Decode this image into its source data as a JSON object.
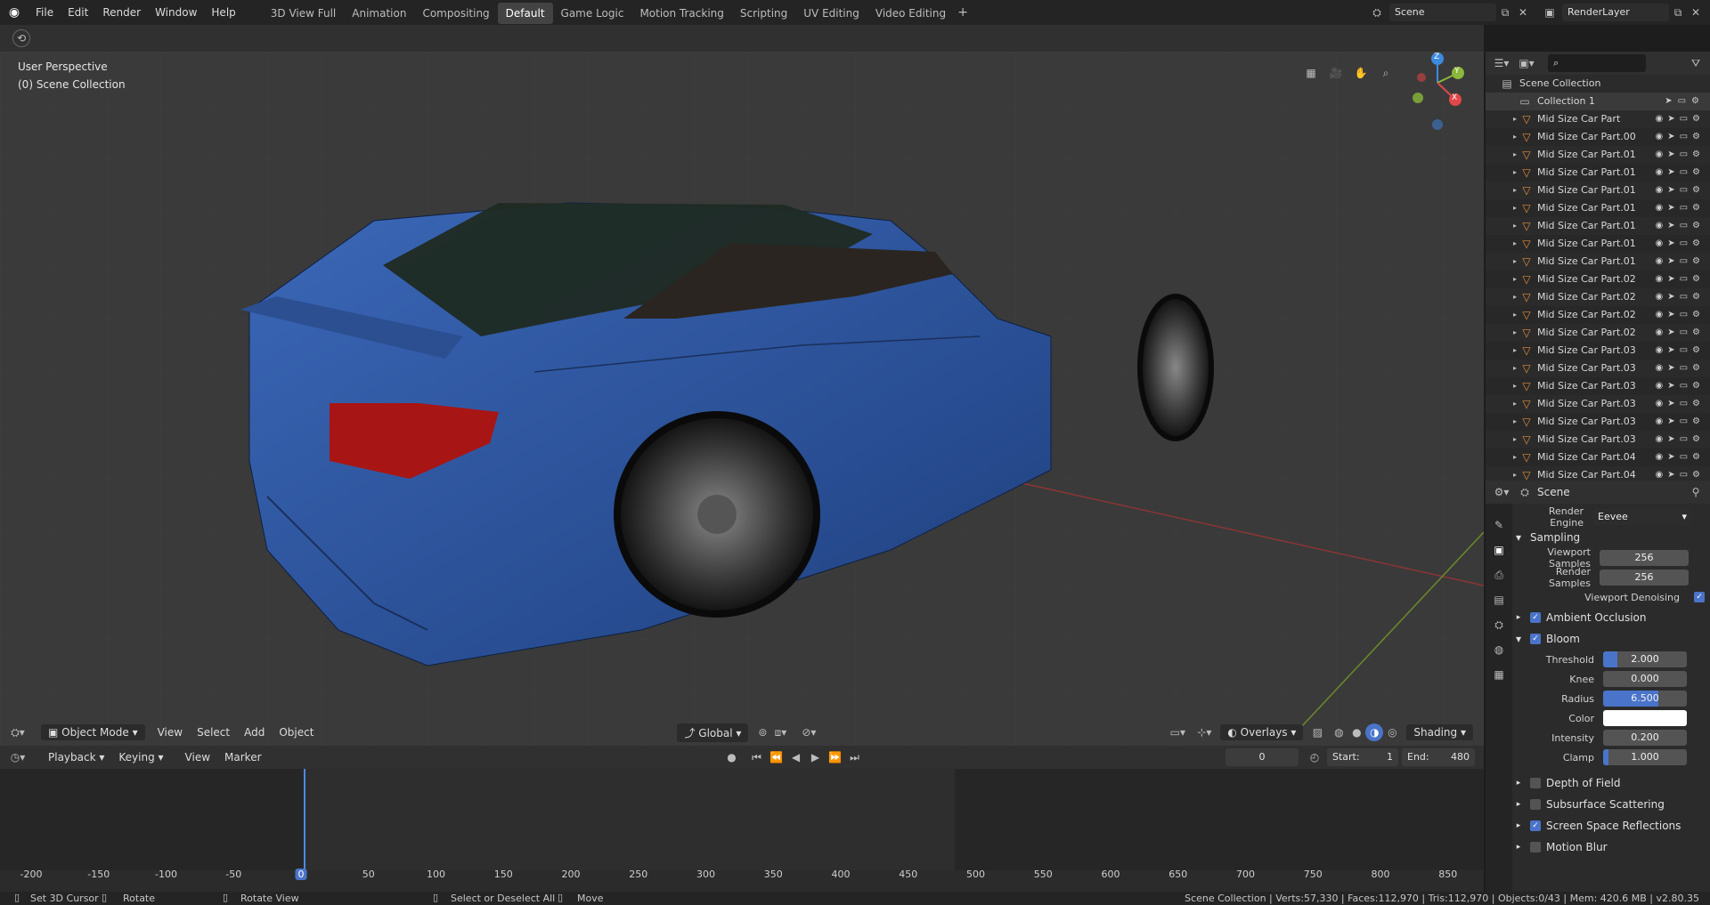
{
  "menu": [
    "File",
    "Edit",
    "Render",
    "Window",
    "Help"
  ],
  "workspaces": [
    {
      "label": "3D View Full",
      "active": false
    },
    {
      "label": "Animation",
      "active": false
    },
    {
      "label": "Compositing",
      "active": false
    },
    {
      "label": "Default",
      "active": true
    },
    {
      "label": "Game Logic",
      "active": false
    },
    {
      "label": "Motion Tracking",
      "active": false
    },
    {
      "label": "Scripting",
      "active": false
    },
    {
      "label": "UV Editing",
      "active": false
    },
    {
      "label": "Video Editing",
      "active": false
    }
  ],
  "scene_field": "Scene",
  "renderlayer_field": "RenderLayer",
  "viewport": {
    "perspective": "User Perspective",
    "collection": "(0) Scene Collection",
    "mode": "Object Mode",
    "menus": [
      "View",
      "Select",
      "Add",
      "Object"
    ],
    "transform": "Global",
    "overlays": "Overlays",
    "shading": "Shading",
    "gizmo": {
      "z": "Z",
      "y": "Y",
      "x": "X"
    }
  },
  "timeline": {
    "menus": [
      "Playback",
      "Keying",
      "View",
      "Marker"
    ],
    "current_frame": "0",
    "start_label": "Start:",
    "start": "1",
    "end_label": "End:",
    "end": "480",
    "ticks": [
      "-200",
      "-150",
      "-100",
      "-50",
      "0",
      "50",
      "100",
      "150",
      "200",
      "250",
      "300",
      "350",
      "400",
      "450",
      "500",
      "550",
      "600",
      "650",
      "700",
      "750",
      "800",
      "850"
    ]
  },
  "status": {
    "set_cursor": "Set 3D Cursor",
    "rotate": "Rotate",
    "rotate_view": "Rotate View",
    "select": "Select or Deselect All",
    "move": "Move",
    "info": "Scene Collection | Verts:57,330 | Faces:112,970 | Tris:112,970 | Objects:0/43 | Mem: 420.6 MB | v2.80.35"
  },
  "outliner": {
    "root": "Scene Collection",
    "collection": "Collection 1",
    "items": [
      "Mid Size Car Part",
      "Mid Size Car Part.00",
      "Mid Size Car Part.01",
      "Mid Size Car Part.01",
      "Mid Size Car Part.01",
      "Mid Size Car Part.01",
      "Mid Size Car Part.01",
      "Mid Size Car Part.01",
      "Mid Size Car Part.01",
      "Mid Size Car Part.02",
      "Mid Size Car Part.02",
      "Mid Size Car Part.02",
      "Mid Size Car Part.02",
      "Mid Size Car Part.03",
      "Mid Size Car Part.03",
      "Mid Size Car Part.03",
      "Mid Size Car Part.03",
      "Mid Size Car Part.03",
      "Mid Size Car Part.03",
      "Mid Size Car Part.04",
      "Mid Size Car Part.04"
    ]
  },
  "properties": {
    "context": "Scene",
    "render_engine_label": "Render Engine",
    "render_engine": "Eevee",
    "sampling": "Sampling",
    "viewport_samples_label": "Viewport Samples",
    "viewport_samples": "256",
    "render_samples_label": "Render Samples",
    "render_samples": "256",
    "viewport_denoising_label": "Viewport Denoising",
    "ambient_occlusion": "Ambient Occlusion",
    "bloom": "Bloom",
    "threshold_label": "Threshold",
    "threshold": "2.000",
    "knee_label": "Knee",
    "knee": "0.000",
    "radius_label": "Radius",
    "radius": "6.500",
    "color_label": "Color",
    "intensity_label": "Intensity",
    "intensity": "0.200",
    "clamp_label": "Clamp",
    "clamp": "1.000",
    "depth_of_field": "Depth of Field",
    "subsurface": "Subsurface Scattering",
    "ssr": "Screen Space Reflections",
    "motion_blur": "Motion Blur"
  },
  "colors": {
    "accent": "#4a74c9",
    "object_icon": "#e38d3c",
    "car_body": "#2f5aa8"
  }
}
